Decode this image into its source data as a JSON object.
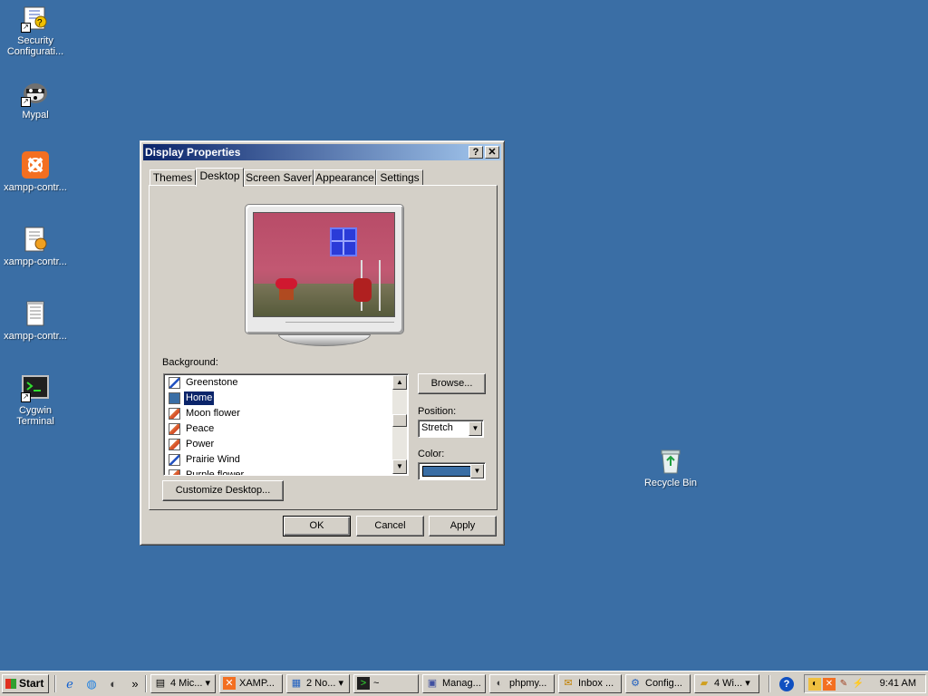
{
  "desktop": {
    "icons": [
      {
        "label": "Security Configurati...",
        "icon": "security-config-icon"
      },
      {
        "label": "Mypal",
        "icon": "raccoon-icon"
      },
      {
        "label": "xampp-contr...",
        "icon": "xampp-icon"
      },
      {
        "label": "xampp-contr...",
        "icon": "config-file-icon"
      },
      {
        "label": "xampp-contr...",
        "icon": "text-file-icon"
      },
      {
        "label": "Cygwin Terminal",
        "icon": "terminal-icon"
      },
      {
        "label": "Recycle Bin",
        "icon": "recycle-bin-icon"
      }
    ]
  },
  "dialog": {
    "title": "Display Properties",
    "help_btn": "?",
    "close_btn": "✕",
    "tabs": [
      "Themes",
      "Desktop",
      "Screen Saver",
      "Appearance",
      "Settings"
    ],
    "active_tab": "Desktop",
    "background_label": "Background:",
    "background_items": [
      {
        "name": "Greenstone",
        "type": "pat"
      },
      {
        "name": "Home",
        "type": "none",
        "selected": true
      },
      {
        "name": "Moon flower",
        "type": "bmp"
      },
      {
        "name": "Peace",
        "type": "bmp"
      },
      {
        "name": "Power",
        "type": "bmp"
      },
      {
        "name": "Prairie Wind",
        "type": "pat"
      },
      {
        "name": "Purple flower",
        "type": "bmp"
      }
    ],
    "browse_btn": "Browse...",
    "position_label": "Position:",
    "position_value": "Stretch",
    "color_label": "Color:",
    "color_value": "#3a6ea5",
    "customize_btn": "Customize Desktop...",
    "ok_btn": "OK",
    "cancel_btn": "Cancel",
    "apply_btn": "Apply"
  },
  "taskbar": {
    "start_label": "Start",
    "quick_launch": [
      "ie-icon",
      "ie-globe-icon",
      "raccoon-icon"
    ],
    "more": "»",
    "tasks": [
      {
        "label": "4 Mic...",
        "icon": "group-icon",
        "group": true
      },
      {
        "label": "XAMP...",
        "icon": "xampp-icon"
      },
      {
        "label": "2 No...",
        "icon": "notepad-icon",
        "group": true
      },
      {
        "label": "~",
        "icon": "terminal-icon"
      },
      {
        "label": "Manag...",
        "icon": "manage-icon"
      },
      {
        "label": "phpmy...",
        "icon": "raccoon-icon"
      },
      {
        "label": "Inbox ...",
        "icon": "mail-icon"
      },
      {
        "label": "Config...",
        "icon": "config-icon"
      },
      {
        "label": "4 Wi...",
        "icon": "folder-icon",
        "group": true
      }
    ],
    "help_icon": "?",
    "clock": "9:41 AM"
  }
}
